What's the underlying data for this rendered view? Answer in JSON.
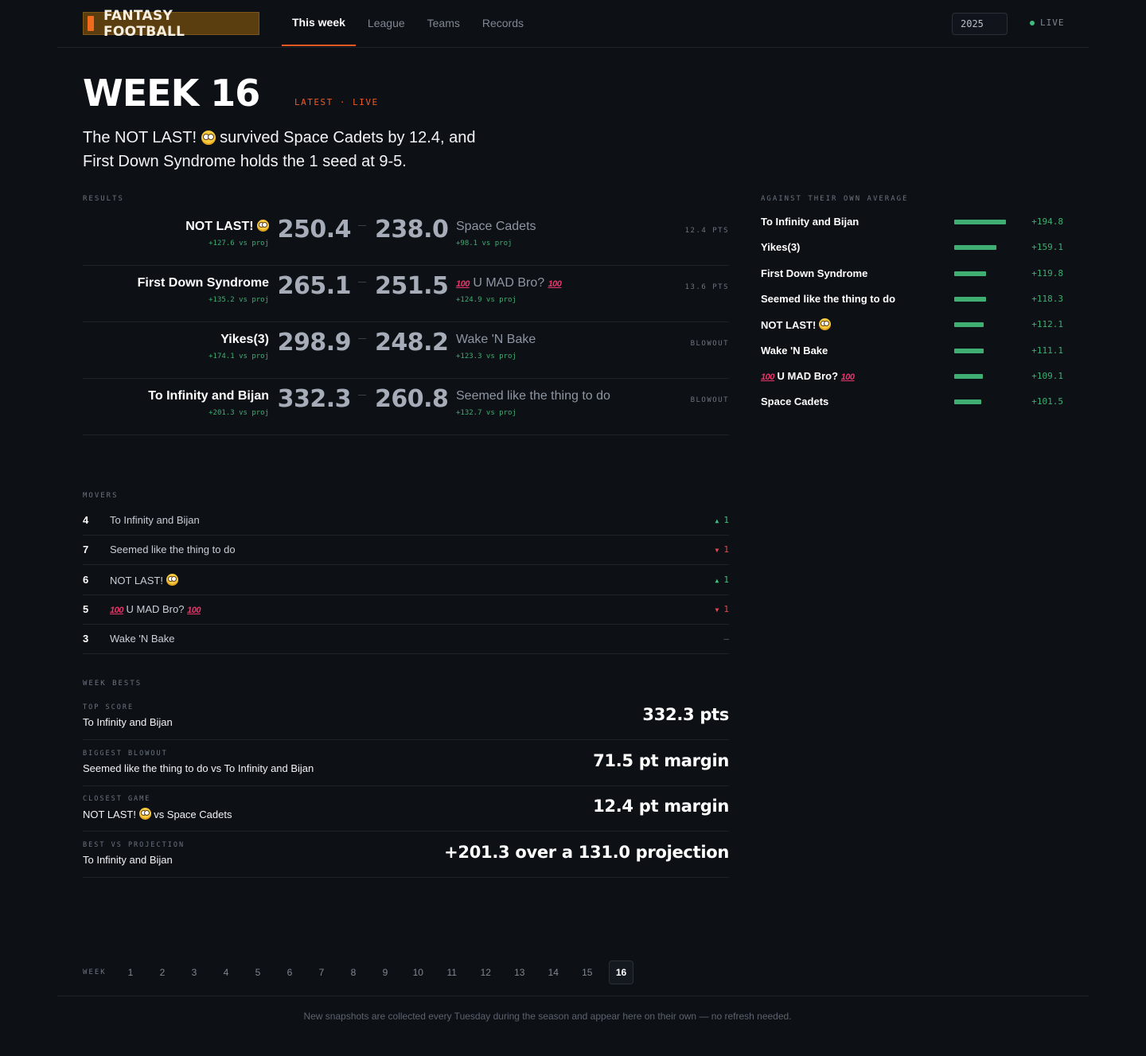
{
  "brand": "FANTASY FOOTBALL",
  "nav": [
    "This week",
    "League",
    "Teams",
    "Records"
  ],
  "year": "2025",
  "live": "LIVE",
  "hero": {
    "title": "WEEK 16",
    "tag": "LATEST · LIVE",
    "sub_1": "The NOT LAST!",
    "sub_2": " survived Space Cadets by 12.4, and",
    "sub_3": "First Down Syndrome holds the 1 seed at 9-5."
  },
  "results": {
    "label": "RESULTS",
    "matches": [
      {
        "left_name": "NOT LAST!",
        "left_face": true,
        "left_proj": "+127.6 vs proj",
        "left_score": "250.4",
        "right_score": "238.0",
        "right_name": "Space Cadets",
        "right_proj": "+98.1 vs proj",
        "margin": "12.4 PTS"
      },
      {
        "left_name": "First Down Syndrome",
        "left_proj": "+135.2 vs proj",
        "left_score": "265.1",
        "right_score": "251.5",
        "right_name": "U MAD Bro?",
        "right_hundred": true,
        "right_proj": "+124.9 vs proj",
        "margin": "13.6 PTS"
      },
      {
        "left_name": "Yikes(3)",
        "left_proj": "+174.1 vs proj",
        "left_score": "298.9",
        "right_score": "248.2",
        "right_name": "Wake 'N Bake",
        "right_proj": "+123.3 vs proj",
        "margin": "BLOWOUT"
      },
      {
        "left_name": "To Infinity and Bijan",
        "left_proj": "+201.3 vs proj",
        "left_score": "332.3",
        "right_score": "260.8",
        "right_name": "Seemed like the thing to do",
        "right_proj": "+132.7 vs proj",
        "margin": "BLOWOUT"
      }
    ]
  },
  "average": {
    "label": "AGAINST THEIR OWN AVERAGE",
    "rows": [
      {
        "name": "To Infinity and Bijan",
        "value": "+194.8",
        "amount": 194.8
      },
      {
        "name": "Yikes(3)",
        "value": "+159.1",
        "amount": 159.1
      },
      {
        "name": "First Down Syndrome",
        "value": "+119.8",
        "amount": 119.8
      },
      {
        "name": "Seemed like the thing to do",
        "value": "+118.3",
        "amount": 118.3
      },
      {
        "name": "NOT LAST!",
        "face": true,
        "value": "+112.1",
        "amount": 112.1
      },
      {
        "name": "Wake 'N Bake",
        "value": "+111.1",
        "amount": 111.1
      },
      {
        "name": "U MAD Bro?",
        "hundred": true,
        "value": "+109.1",
        "amount": 109.1
      },
      {
        "name": "Space Cadets",
        "value": "+101.5",
        "amount": 101.5
      }
    ]
  },
  "movers": {
    "label": "MOVERS",
    "rows": [
      {
        "rank": "4",
        "name": "To Infinity and Bijan",
        "arrow": "▲",
        "delta": "1",
        "dir": "up"
      },
      {
        "rank": "7",
        "name": "Seemed like the thing to do",
        "arrow": "▼",
        "delta": "1",
        "dir": "down"
      },
      {
        "rank": "6",
        "name": "NOT LAST!",
        "face": true,
        "arrow": "▲",
        "delta": "1",
        "dir": "up"
      },
      {
        "rank": "5",
        "name": "U MAD Bro?",
        "hundred": true,
        "arrow": "▼",
        "delta": "1",
        "dir": "down"
      },
      {
        "rank": "3",
        "name": "Wake 'N Bake",
        "arrow": "",
        "delta": "–",
        "dir": "flat"
      }
    ]
  },
  "bests": {
    "label": "WEEK BESTS",
    "rows": [
      {
        "label": "TOP SCORE",
        "who": "To Infinity and Bijan",
        "value": "332.3 pts"
      },
      {
        "label": "BIGGEST BLOWOUT",
        "who": "Seemed like the thing to do vs To Infinity and Bijan",
        "value": "71.5 pt margin"
      },
      {
        "label": "CLOSEST GAME",
        "who_1": "NOT LAST!",
        "who_2": " vs Space Cadets",
        "value": "12.4 pt margin"
      },
      {
        "label": "BEST VS PROJECTION",
        "who": "To Infinity and Bijan",
        "value": "+201.3 over a 131.0 projection"
      }
    ]
  },
  "weeks": {
    "label": "WEEK",
    "items": [
      "1",
      "2",
      "3",
      "4",
      "5",
      "6",
      "7",
      "8",
      "9",
      "10",
      "11",
      "12",
      "13",
      "14",
      "15",
      "16"
    ],
    "active": "16"
  },
  "footer": "New snapshots are collected every Tuesday during the season and appear here on their own — no refresh needed.",
  "colors": {
    "accent": "#ee5a24",
    "positive": "#3fae72",
    "negative": "#e5484d",
    "background": "#0d1015"
  },
  "icons": {
    "brand": "brand-bar-icon",
    "face": "flushed-face-icon",
    "hundred": "hundred-points-icon",
    "live": "live-dot-icon"
  }
}
